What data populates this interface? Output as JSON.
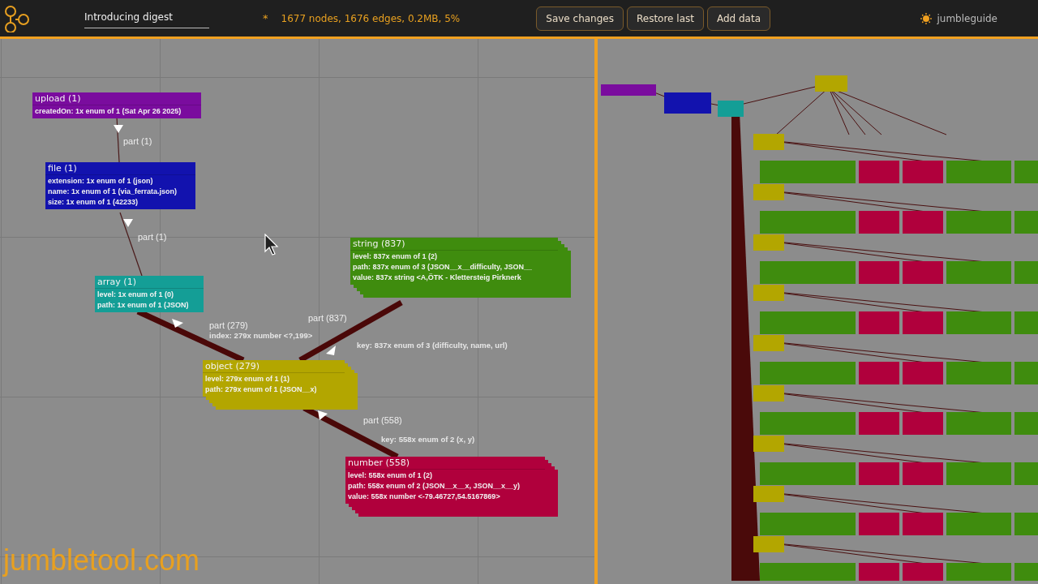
{
  "header": {
    "title_field": {
      "value": "Introducing digest"
    },
    "unsaved_mark": "*",
    "stats": "1677 nodes, 1676 edges, 0.2MB, 5%",
    "buttons": [
      "Save changes",
      "Restore last",
      "Add data"
    ],
    "brand": "jumbleguide"
  },
  "schema_graph": {
    "nodes": [
      {
        "title": "upload (1)",
        "color": "#7a0c9e",
        "stacked": false,
        "fields": [
          "createdOn:  1x enum of 1 (Sat Apr 26 2025)"
        ]
      },
      {
        "title": "file (1)",
        "color": "#1212ae",
        "stacked": false,
        "fields": [
          "extension:  1x enum of 1 (json)",
          "name:  1x enum of 1 (via_ferrata.json)",
          "size:  1x enum of 1 (42233)"
        ]
      },
      {
        "title": "array (1)",
        "color": "#149e96",
        "stacked": false,
        "fields": [
          "level:  1x enum of 1 (0)",
          "path:  1x enum of 1 (JSON)"
        ]
      },
      {
        "title": "object (279)",
        "color": "#b3a600",
        "stacked": true,
        "fields": [
          "level:  279x enum of 1 (1)",
          "path:  279x enum of 1 (JSON__x)"
        ]
      },
      {
        "title": "string (837)",
        "color": "#3f8c0e",
        "stacked": true,
        "fields": [
          "level:  837x enum of 1 (2)",
          "path:  837x enum of 3 (JSON__x__difficulty, JSON__",
          "value:  837x string <A,ÖTK - Klettersteig Pirknerk"
        ]
      },
      {
        "title": "number (558)",
        "color": "#b0003c",
        "stacked": true,
        "fields": [
          "level:  558x enum of 1 (2)",
          "path:  558x enum of 2 (JSON__x__x, JSON__x__y)",
          "value:  558x number <-79.46727,54.5167869>"
        ]
      }
    ],
    "edges": [
      {
        "label": "part (1)"
      },
      {
        "label": "part (1)"
      },
      {
        "label": "part (279)",
        "detail": "index:  279x number <?,199>"
      },
      {
        "label": "part (837)",
        "detail": "key:  837x enum of 3 (difficulty, name, url)"
      },
      {
        "label": "part (558)",
        "detail": "key:  558x enum of 2 (x, y)"
      }
    ]
  },
  "overlay_caption": "jumbletool.com"
}
